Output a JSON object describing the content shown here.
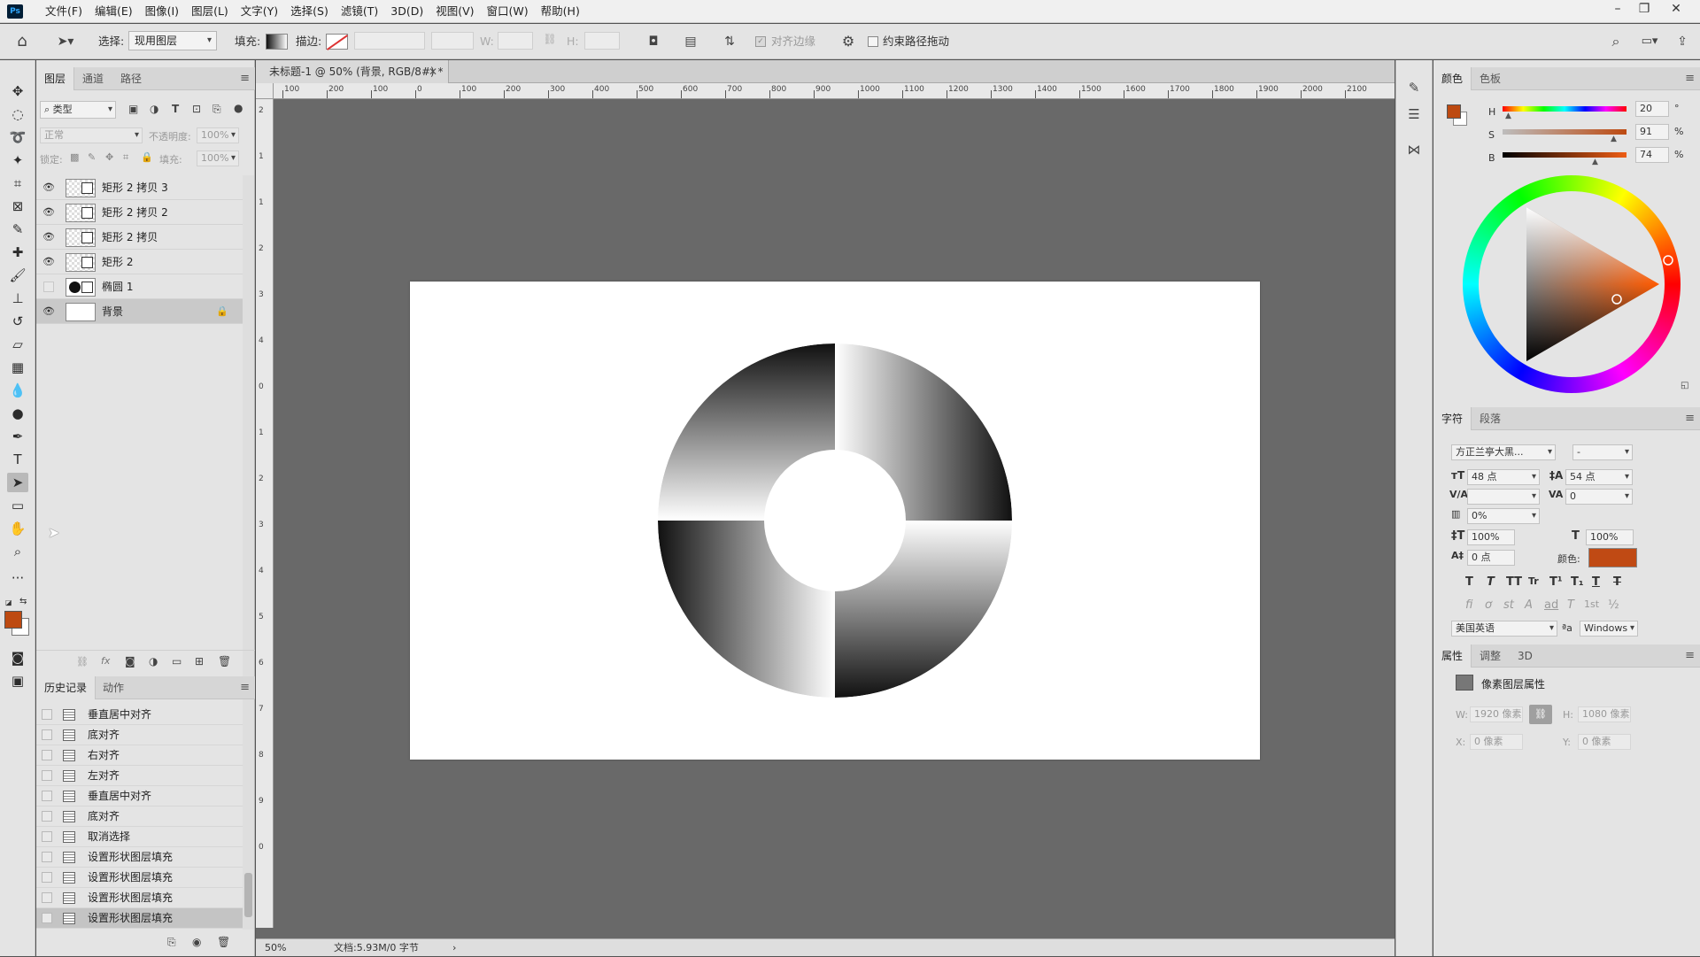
{
  "app": {
    "logo": "Ps"
  },
  "menu": [
    "文件(F)",
    "编辑(E)",
    "图像(I)",
    "图层(L)",
    "文字(Y)",
    "选择(S)",
    "滤镜(T)",
    "3D(D)",
    "视图(V)",
    "窗口(W)",
    "帮助(H)"
  ],
  "window_controls": {
    "minimize": "–",
    "restore": "❐",
    "close": "✕"
  },
  "options": {
    "select_label": "选择:",
    "select_value": "现用图层",
    "fill_label": "填充:",
    "stroke_label": "描边:",
    "w_label": "W:",
    "h_label": "H:",
    "align_edges": "对齐边缘",
    "constrain_path": "约束路径拖动"
  },
  "layers_panel": {
    "tabs": [
      "图层",
      "通道",
      "路径"
    ],
    "filter_kind": "类型",
    "blend_mode": "正常",
    "opacity_label": "不透明度:",
    "opacity_value": "100%",
    "lock_label": "锁定:",
    "fill_label": "填充:",
    "fill_value": "100%",
    "layers": [
      {
        "name": "矩形 2 拷贝 3",
        "visible": true
      },
      {
        "name": "矩形 2 拷贝 2",
        "visible": true
      },
      {
        "name": "矩形 2 拷贝",
        "visible": true
      },
      {
        "name": "矩形 2",
        "visible": true
      },
      {
        "name": "椭圆 1",
        "visible": false
      },
      {
        "name": "背景",
        "visible": true,
        "locked": true,
        "selected": true
      }
    ]
  },
  "history_panel": {
    "tabs": [
      "历史记录",
      "动作"
    ],
    "items": [
      "垂直居中对齐",
      "底对齐",
      "右对齐",
      "左对齐",
      "垂直居中对齐",
      "底对齐",
      "取消选择",
      "设置形状图层填充",
      "设置形状图层填充",
      "设置形状图层填充",
      "设置形状图层填充"
    ],
    "selected_index": 10
  },
  "document": {
    "tab_title": "未标题-1 @ 50% (背景, RGB/8#) *",
    "zoom": "50%",
    "doc_info": "文档:5.93M/0 字节",
    "ruler_h": [
      "100",
      "200",
      "100",
      "0",
      "100",
      "200",
      "300",
      "400",
      "500",
      "600",
      "700",
      "800",
      "900",
      "1000",
      "1100",
      "1200",
      "1300",
      "1400",
      "1500",
      "1600",
      "1700",
      "1800",
      "1900",
      "2000",
      "2100"
    ],
    "ruler_v": [
      "2",
      "1",
      "1",
      "2",
      "3",
      "4",
      "0",
      "1",
      "2",
      "3",
      "4",
      "5",
      "6",
      "7",
      "8",
      "9",
      "0"
    ]
  },
  "color_panel": {
    "tabs": [
      "颜色",
      "色板"
    ],
    "h_label": "H",
    "h_value": "20",
    "h_unit": "°",
    "s_label": "S",
    "s_value": "91",
    "s_unit": "%",
    "b_label": "B",
    "b_value": "74",
    "b_unit": "%",
    "foreground": "#bd4a11",
    "background": "#ffffff"
  },
  "character_panel": {
    "tabs": [
      "字符",
      "段落"
    ],
    "font_family": "方正兰亭大黑...",
    "font_style": "-",
    "size": "48 点",
    "leading": "54 点",
    "kerning": "",
    "tracking": "0",
    "scale_pct": "0%",
    "vscale": "100%",
    "hscale": "100%",
    "baseline": "0 点",
    "color_label": "颜色:",
    "color": "#c04a14",
    "styles": [
      "T",
      "T",
      "TT",
      "Tr",
      "T¹",
      "T₁",
      "T",
      "T"
    ],
    "opentype": [
      "fi",
      "ơ",
      "st",
      "A",
      "ad",
      "T",
      "1st",
      "½"
    ],
    "language": "美国英语",
    "aa_label": "ªa",
    "aa_value": "Windows"
  },
  "properties_panel": {
    "tabs": [
      "属性",
      "调整",
      "3D"
    ],
    "title": "像素图层属性",
    "w_label": "W:",
    "w_value": "1920 像素",
    "h_label": "H:",
    "h_value": "1080 像素",
    "x_label": "X:",
    "x_value": "0 像素",
    "y_label": "Y:",
    "y_value": "0 像素"
  }
}
